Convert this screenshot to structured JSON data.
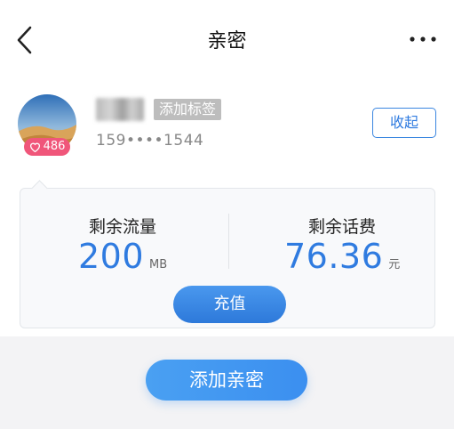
{
  "nav": {
    "title": "亲密"
  },
  "member": {
    "tag_label": "添加标签",
    "phone": "159••••1544",
    "heart_count": "486",
    "collapse_label": "收起"
  },
  "stats": {
    "data_label": "剩余流量",
    "data_value": "200",
    "data_unit": "MB",
    "fee_label": "剩余话费",
    "fee_value": "76.36",
    "fee_unit": "元"
  },
  "actions": {
    "recharge_label": "充值",
    "add_label": "添加亲密"
  },
  "colors": {
    "accent": "#2f7be0",
    "heart_badge": "#f0567a",
    "footer_bg": "#f3f3f5"
  },
  "icons": [
    "back-arrow-icon",
    "more-dots-icon",
    "heart-icon"
  ]
}
